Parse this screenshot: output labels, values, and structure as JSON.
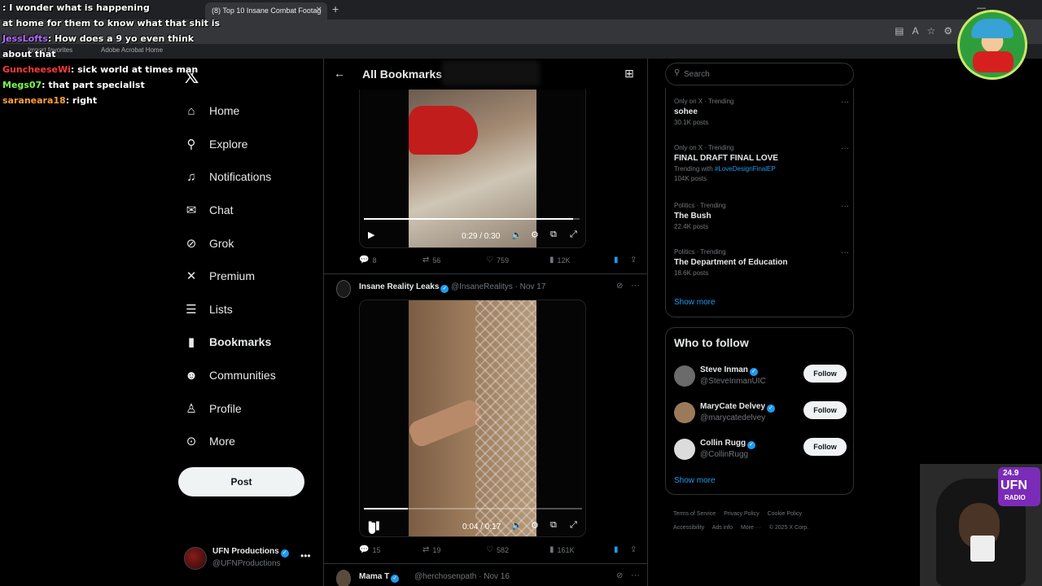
{
  "browser": {
    "tab_title": "(8) Top 10 Insane Combat Footag",
    "bookmarks": [
      "Import favorites",
      "Adobe Acrobat Home"
    ]
  },
  "chat": [
    {
      "user": "",
      "text": "I wonder what is happening",
      "color": "#ff4d6d"
    },
    {
      "user": "",
      "text": "at home for them to know what that shit is",
      "color": "#ffffff"
    },
    {
      "user": "JessLofts",
      "text": "How does a 9 yo even think about that",
      "color": "#b56bff"
    },
    {
      "user": "GuncheeseWi",
      "text": "sick world at times man",
      "color": "#ff3b3b"
    },
    {
      "user": "Megs07",
      "text": "that part specialist",
      "color": "#7bff4a"
    },
    {
      "user": "saraneara18",
      "text": "right",
      "color": "#ff9f3b"
    }
  ],
  "nav": {
    "logo": "𝕏",
    "items": [
      {
        "label": "Home",
        "icon": "home-icon",
        "glyph": "⌂"
      },
      {
        "label": "Explore",
        "icon": "search-icon",
        "glyph": "⚲"
      },
      {
        "label": "Notifications",
        "icon": "bell-icon",
        "glyph": "♫"
      },
      {
        "label": "Chat",
        "icon": "mail-icon",
        "glyph": "✉"
      },
      {
        "label": "Grok",
        "icon": "grok-icon",
        "glyph": "⊘"
      },
      {
        "label": "Premium",
        "icon": "x-icon",
        "glyph": "✕"
      },
      {
        "label": "Lists",
        "icon": "list-icon",
        "glyph": "☰"
      },
      {
        "label": "Bookmarks",
        "icon": "bookmark-icon",
        "glyph": "▮"
      },
      {
        "label": "Communities",
        "icon": "communities-icon",
        "glyph": "☻"
      },
      {
        "label": "Profile",
        "icon": "profile-icon",
        "glyph": "♙"
      },
      {
        "label": "More",
        "icon": "more-circle-icon",
        "glyph": "⊙"
      }
    ],
    "post_label": "Post",
    "account": {
      "name": "UFN Productions",
      "handle": "@UFNProductions",
      "more": "•••"
    }
  },
  "center": {
    "title": "All Bookmarks",
    "tweet1": {
      "video_time": "0:29 / 0:30",
      "progress": 0.97,
      "replies": "8",
      "reposts": "56",
      "likes": "759",
      "views": "12K"
    },
    "tweet2": {
      "name": "Insane Reality Leaks",
      "handle": "@InsaneRealitys",
      "date": "· Nov 17",
      "video_time": "0:04 / 0:17",
      "progress": 0.2,
      "replies": "15",
      "reposts": "19",
      "likes": "582",
      "views": "161K"
    },
    "tweet3": {
      "name": "Mama T",
      "handle": "@herchosenpath",
      "date": "· Nov 16"
    }
  },
  "right": {
    "search_placeholder": "Search",
    "trends": [
      {
        "category": "Only on X · Trending",
        "name": "sohee",
        "sub": "",
        "tag": "",
        "posts": "30.1K posts"
      },
      {
        "category": "Only on X · Trending",
        "name": "FINAL DRAFT FINAL LOVE",
        "sub": "Trending with ",
        "tag": "#LoveDesignFinalEP",
        "posts": "104K posts"
      },
      {
        "category": "Politics · Trending",
        "name": "The Bush",
        "sub": "",
        "tag": "",
        "posts": "22.4K posts"
      },
      {
        "category": "Politics · Trending",
        "name": "The Department of Education",
        "sub": "",
        "tag": "",
        "posts": "18.6K posts"
      }
    ],
    "trends_show_more": "Show more",
    "who_to_follow": {
      "title": "Who to follow",
      "people": [
        {
          "name": "Steve Inman",
          "handle": "@SteveInmanUIC",
          "follow": "Follow"
        },
        {
          "name": "MaryCate Delvey",
          "handle": "@marycatedelvey",
          "follow": "Follow"
        },
        {
          "name": "Collin Rugg",
          "handle": "@CollinRugg",
          "follow": "Follow"
        }
      ],
      "show_more": "Show more"
    },
    "footer": [
      "Terms of Service",
      "Privacy Policy",
      "Cookie Policy",
      "Accessibility",
      "Ads info",
      "More ···",
      "© 2025 X Corp."
    ]
  },
  "overlay": {
    "radio_freq": "24.9",
    "radio_name": "UFN",
    "radio_sub": "RADIO"
  }
}
